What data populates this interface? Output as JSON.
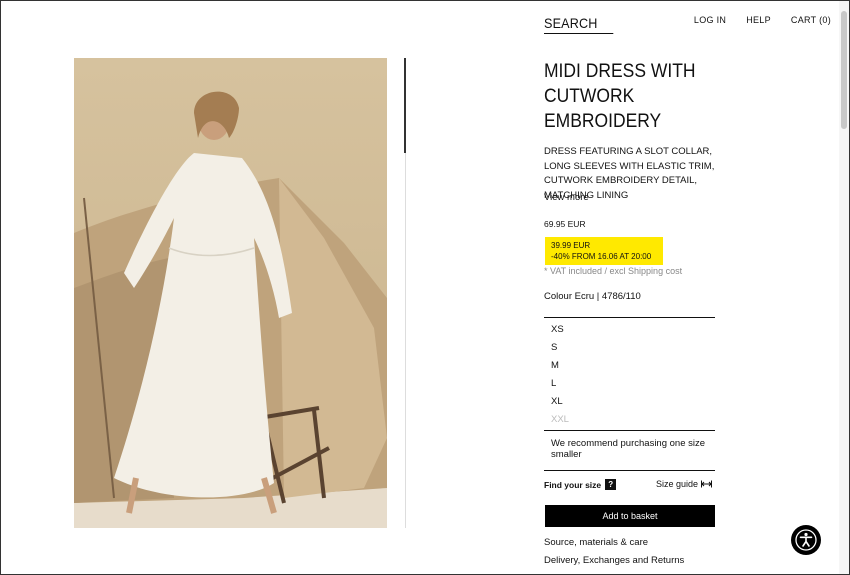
{
  "header": {
    "search_label": "SEARCH",
    "login_label": "LOG IN",
    "help_label": "HELP",
    "cart_label": "CART (0)"
  },
  "product": {
    "title": "MIDI DRESS WITH CUTWORK EMBROIDERY",
    "description": "DRESS FEATURING A SLOT COLLAR, LONG SLEEVES WITH ELASTIC TRIM, CUTWORK EMBROIDERY DETAIL, MATCHING LINING",
    "view_more": "View more",
    "old_price": "69.95 EUR",
    "sale_price": "39.99 EUR",
    "sale_note": "-40% FROM 16.06 AT 20:00",
    "vat_note": "* VAT included / excl Shipping cost",
    "colour": "Colour Ecru | 4786/110",
    "sale_color": "#ffe900"
  },
  "sizes": [
    {
      "label": "XS",
      "available": true
    },
    {
      "label": "S",
      "available": true
    },
    {
      "label": "M",
      "available": true
    },
    {
      "label": "L",
      "available": true
    },
    {
      "label": "XL",
      "available": true
    },
    {
      "label": "XXL",
      "available": false
    }
  ],
  "size_info": {
    "recommend": "We recommend purchasing one size smaller",
    "find_your_size": "Find your size",
    "find_icon": "?",
    "size_guide": "Size guide"
  },
  "actions": {
    "add_to_basket": "Add to basket",
    "source_link": "Source, materials & care",
    "delivery_link": "Delivery, Exchanges and Returns"
  }
}
